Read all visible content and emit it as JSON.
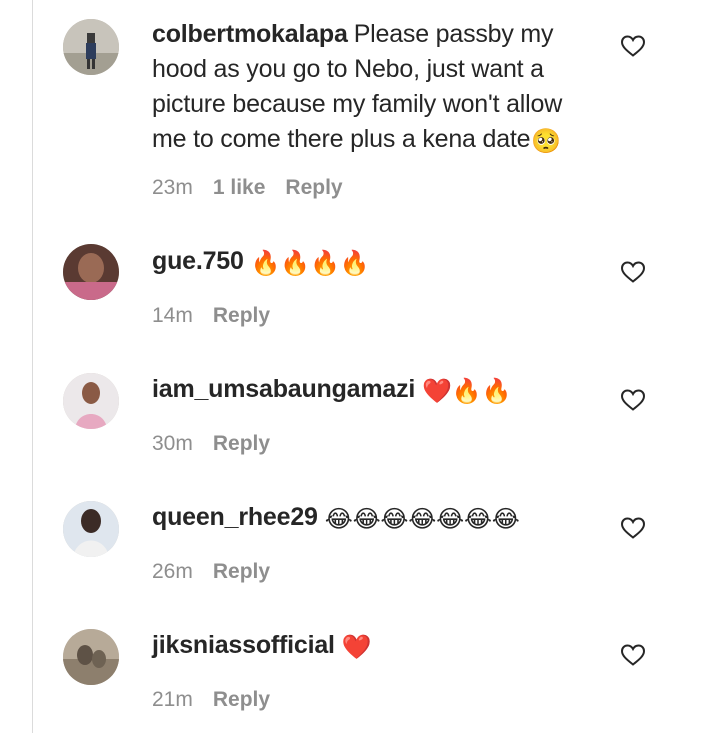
{
  "comments": [
    {
      "username": "colbertmokalapa",
      "text": "Please passby my hood as you go to Nebo, just want a picture because my family won't allow me to come there plus a kena date",
      "emoji": "🥺",
      "time": "23m",
      "likes": "1 like",
      "reply": "Reply"
    },
    {
      "username": "gue.750",
      "text": "",
      "emoji": "🔥🔥🔥🔥",
      "time": "14m",
      "reply": "Reply"
    },
    {
      "username": "iam_umsabaungamazi",
      "text": "",
      "emoji": "❤️🔥🔥",
      "time": "30m",
      "reply": "Reply"
    },
    {
      "username": "queen_rhee29",
      "text": "",
      "emoji": "😂😂😂😂😂😂😂",
      "time": "26m",
      "reply": "Reply"
    },
    {
      "username": "jiksniassofficial",
      "text": "",
      "emoji": "❤️",
      "time": "21m",
      "reply": "Reply"
    }
  ],
  "icons": {
    "like": "heart-outline-icon"
  },
  "colors": {
    "text": "#262626",
    "meta": "#8e8e8e",
    "heart_outline": "#262626"
  }
}
